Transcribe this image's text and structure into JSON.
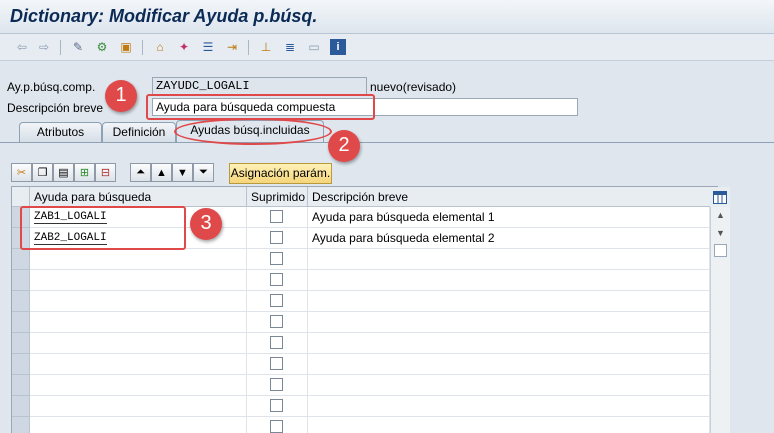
{
  "window": {
    "title": "Dictionary: Modificar Ayuda p.búsq."
  },
  "toolbar": {
    "icons": [
      "back-arrow-icon",
      "forward-arrow-icon",
      "display-change-icon",
      "other-object-icon",
      "activate-icon",
      "where-used-icon",
      "object-list-icon",
      "hierarchy-icon",
      "info-icon"
    ]
  },
  "header": {
    "comp_label": "Ay.p.búsq.comp.",
    "comp_value": "ZAYUDC_LOGALI",
    "status": "nuevo(revisado)",
    "desc_label": "Descripción breve",
    "desc_value": "Ayuda para búsqueda compuesta"
  },
  "tabs": [
    {
      "label": "Atributos"
    },
    {
      "label": "Definición"
    },
    {
      "label": "Ayudas búsq.incluidas",
      "active": true
    }
  ],
  "table_toolbar": {
    "icons": [
      "cut-icon",
      "copy-icon",
      "paste-icon",
      "insert-row-icon",
      "delete-row-icon",
      "first-page-icon",
      "prev-page-icon",
      "next-page-icon",
      "last-page-icon"
    ],
    "assign_label": "Asignación parám."
  },
  "table": {
    "columns": [
      "Ayuda para búsqueda",
      "Suprimido",
      "Descripción breve"
    ],
    "rows": [
      {
        "help": "ZAB1_LOGALI",
        "suppressed": false,
        "desc": "Ayuda para búsqueda elemental 1"
      },
      {
        "help": "ZAB2_LOGALI",
        "suppressed": false,
        "desc": "Ayuda para búsqueda elemental 2"
      },
      {
        "help": "",
        "suppressed": false,
        "desc": ""
      },
      {
        "help": "",
        "suppressed": false,
        "desc": ""
      },
      {
        "help": "",
        "suppressed": false,
        "desc": ""
      },
      {
        "help": "",
        "suppressed": false,
        "desc": ""
      },
      {
        "help": "",
        "suppressed": false,
        "desc": ""
      },
      {
        "help": "",
        "suppressed": false,
        "desc": ""
      },
      {
        "help": "",
        "suppressed": false,
        "desc": ""
      },
      {
        "help": "",
        "suppressed": false,
        "desc": ""
      },
      {
        "help": "",
        "suppressed": false,
        "desc": ""
      }
    ]
  },
  "annotations": {
    "badge1": "1",
    "badge2": "2",
    "badge3": "3",
    "color": "#e0494a"
  }
}
